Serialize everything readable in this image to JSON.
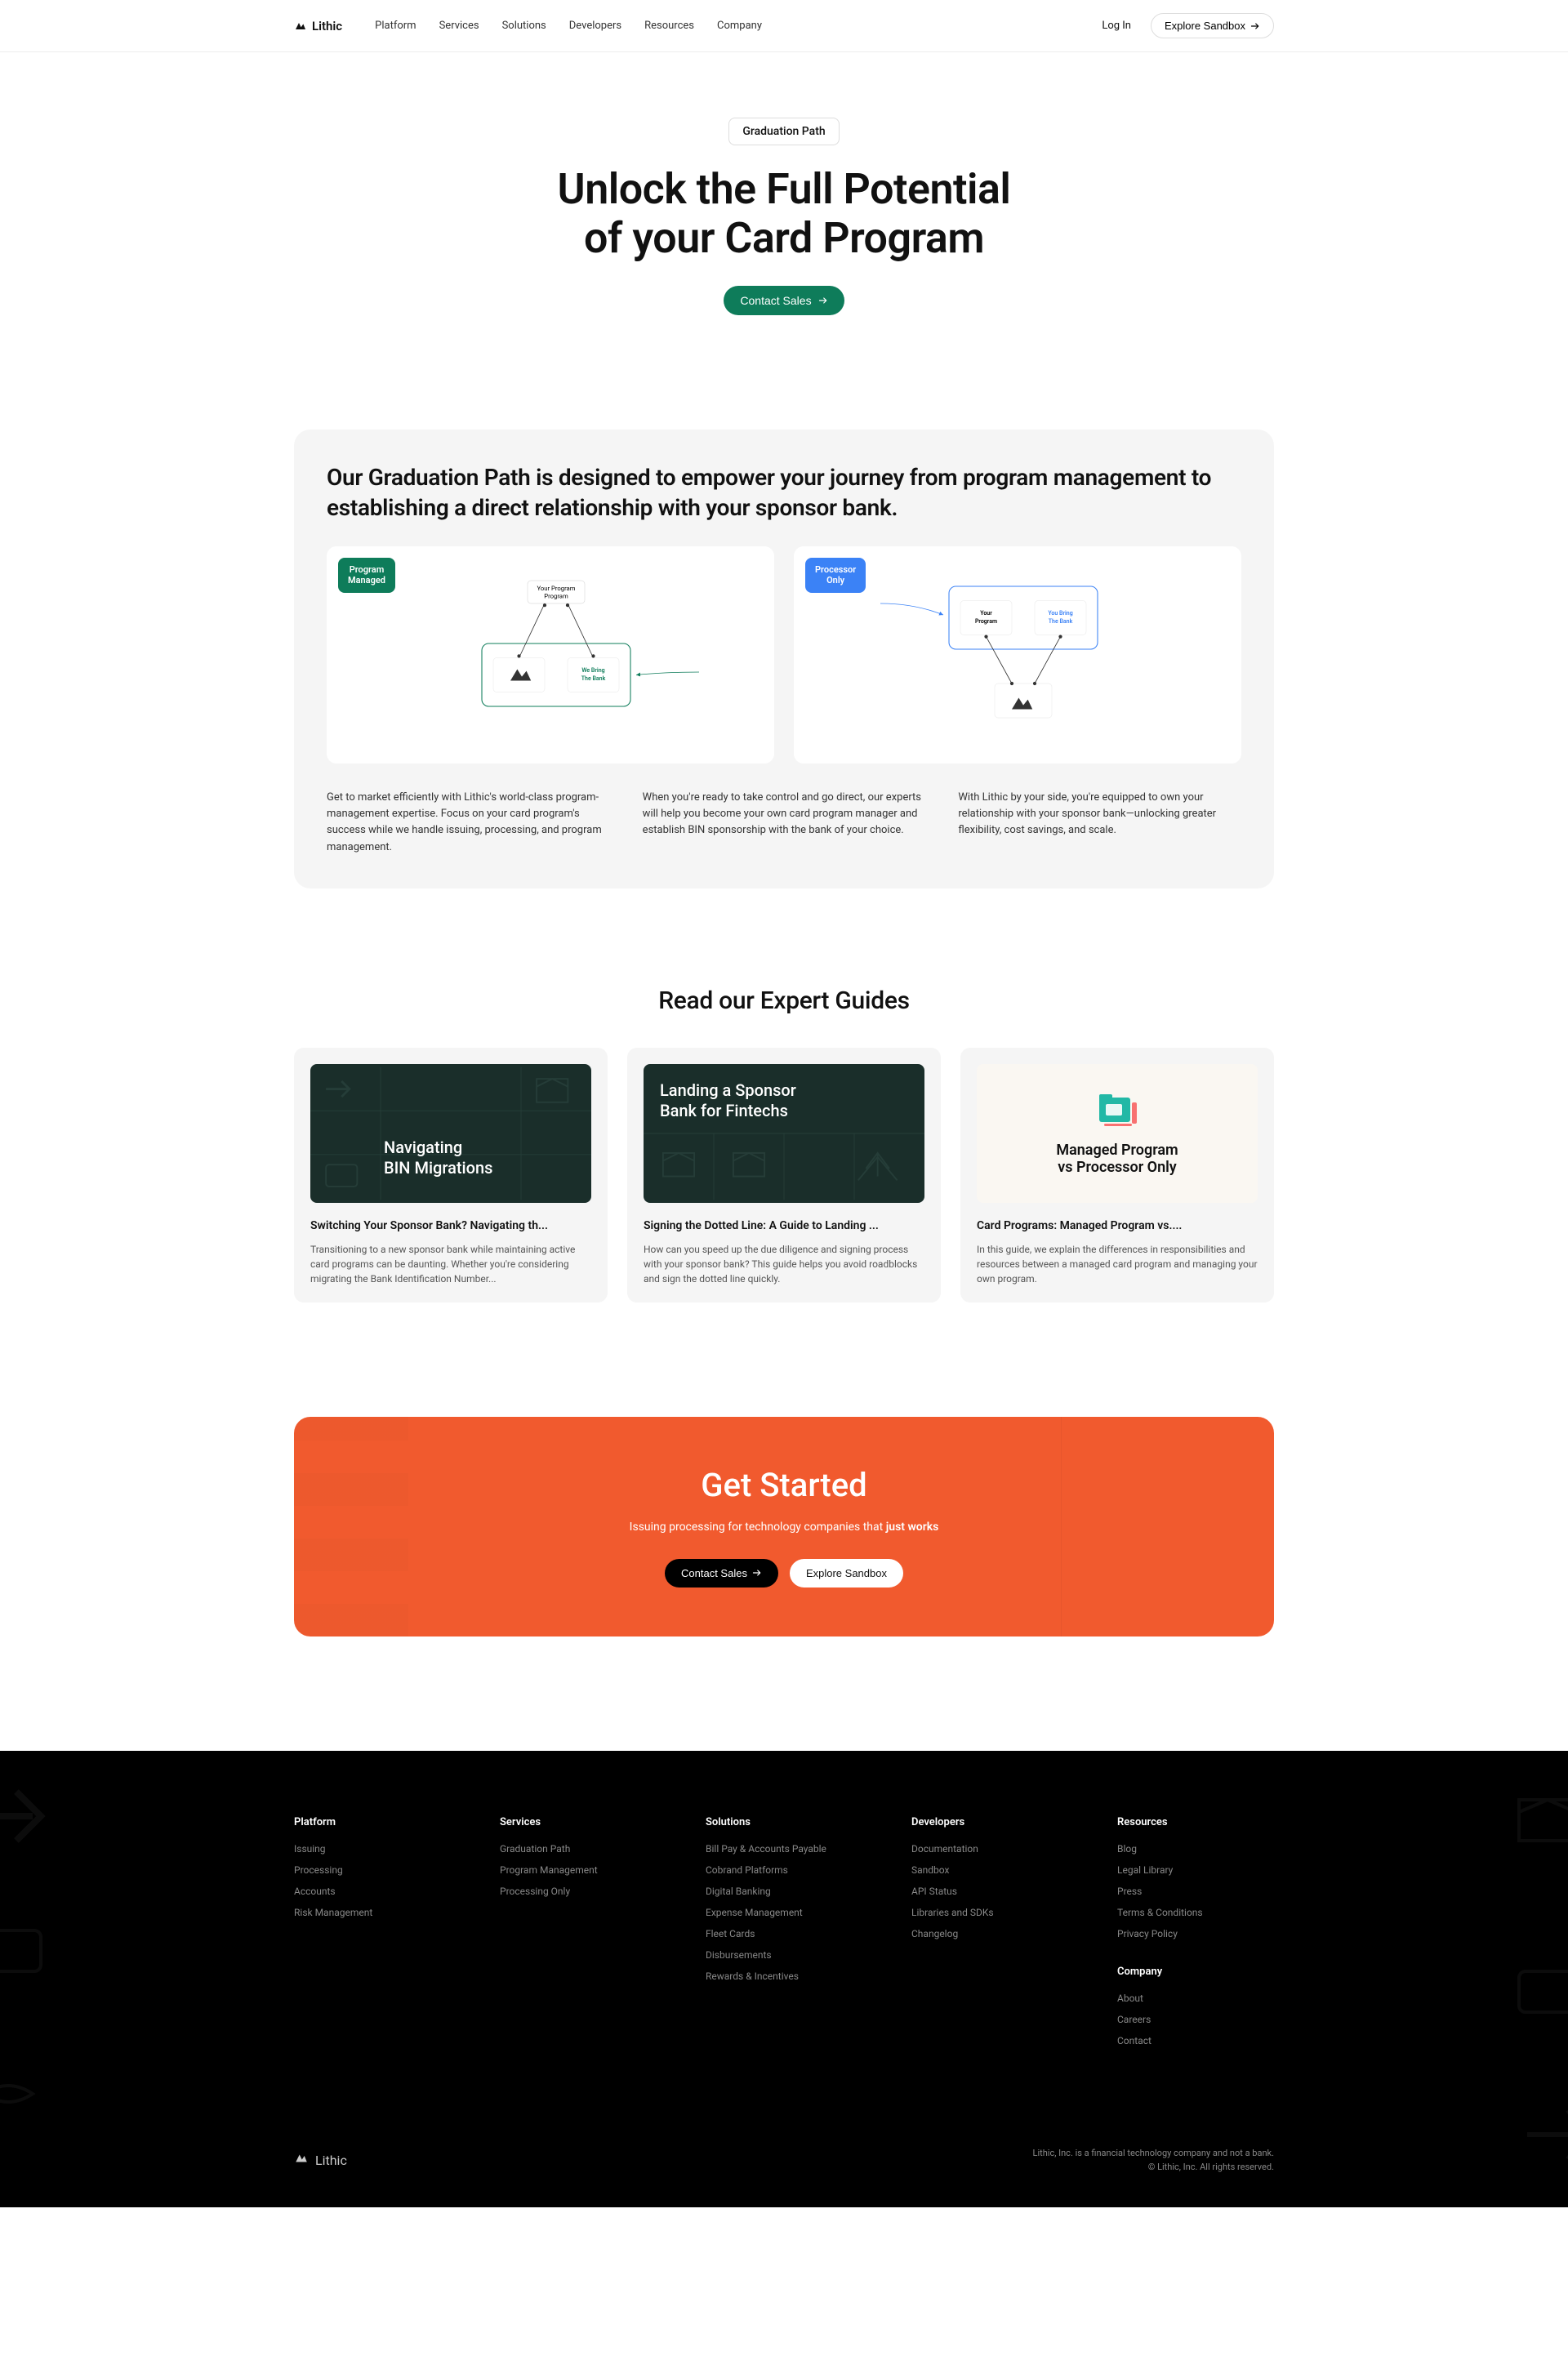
{
  "brand": "Lithic",
  "nav": {
    "items": [
      "Platform",
      "Services",
      "Solutions",
      "Developers",
      "Resources",
      "Company"
    ]
  },
  "header_actions": {
    "login": "Log In",
    "explore": "Explore Sandbox"
  },
  "hero": {
    "badge": "Graduation Path",
    "title_line1": "Unlock the Full Potential",
    "title_line2": "of your Card Program",
    "cta": "Contact Sales"
  },
  "info": {
    "heading": "Our Graduation Path is designed to empower your journey from program management to establishing a direct relationship with your sponsor bank.",
    "diagrams": [
      {
        "tag_line1": "Program",
        "tag_line2": "Managed",
        "node_top": "Your Program",
        "node_right": "We Bring The Bank"
      },
      {
        "tag_line1": "Processor",
        "tag_line2": "Only",
        "node_left": "Your Program",
        "node_right": "You Bring The Bank"
      }
    ],
    "descs": [
      "Get to market efficiently with Lithic's world-class program-management expertise. Focus on your card program's success while we handle issuing, processing, and program management.",
      "When you're ready to take control and go direct, our experts will help you become your own card program manager and establish BIN sponsorship with the bank of your choice.",
      "With Lithic by your side, you're equipped to own your relationship with your sponsor bank—unlocking greater flexibility, cost savings, and scale."
    ]
  },
  "guides": {
    "title": "Read our Expert Guides",
    "items": [
      {
        "img_title_line1": "Navigating",
        "img_title_line2": "BIN Migrations",
        "title": "Switching Your Sponsor Bank? Navigating th...",
        "desc": "Transitioning to a new sponsor bank while maintaining active card programs can be daunting. Whether you're considering migrating the Bank Identification Number..."
      },
      {
        "img_title_line1": "Landing a Sponsor",
        "img_title_line2": "Bank for Fintechs",
        "title": "Signing the Dotted Line: A Guide to Landing ...",
        "desc": "How can you speed up the due diligence and signing process with your sponsor bank? This guide helps you avoid roadblocks and sign the dotted line quickly."
      },
      {
        "img_title_line1": "Managed Program",
        "img_title_line2": "vs Processor Only",
        "title": "Card Programs: Managed Program vs....",
        "desc": "In this guide, we explain the differences in responsibilities and resources between a managed card program and managing your own program."
      }
    ]
  },
  "cta": {
    "title": "Get Started",
    "sub_prefix": "Issuing processing for technology companies that ",
    "sub_bold": "just works",
    "btn1": "Contact Sales",
    "btn2": "Explore Sandbox"
  },
  "footer": {
    "cols": [
      {
        "title": "Platform",
        "links": [
          "Issuing",
          "Processing",
          "Accounts",
          "Risk Management"
        ]
      },
      {
        "title": "Services",
        "links": [
          "Graduation Path",
          "Program Management",
          "Processing Only"
        ]
      },
      {
        "title": "Solutions",
        "links": [
          "Bill Pay & Accounts Payable",
          "Cobrand Platforms",
          "Digital Banking",
          "Expense Management",
          "Fleet Cards",
          "Disbursements",
          "Rewards & Incentives"
        ]
      },
      {
        "title": "Developers",
        "links": [
          "Documentation",
          "Sandbox",
          "API Status",
          "Libraries and SDKs",
          "Changelog"
        ]
      },
      {
        "title": "Resources",
        "links": [
          "Blog",
          "Legal Library",
          "Press",
          "Terms & Conditions",
          "Privacy Policy"
        ],
        "title2": "Company",
        "links2": [
          "About",
          "Careers",
          "Contact"
        ]
      }
    ],
    "legal_line1": "Lithic, Inc. is a financial technology company and not a bank.",
    "legal_line2": "© Lithic, Inc. All rights reserved."
  }
}
